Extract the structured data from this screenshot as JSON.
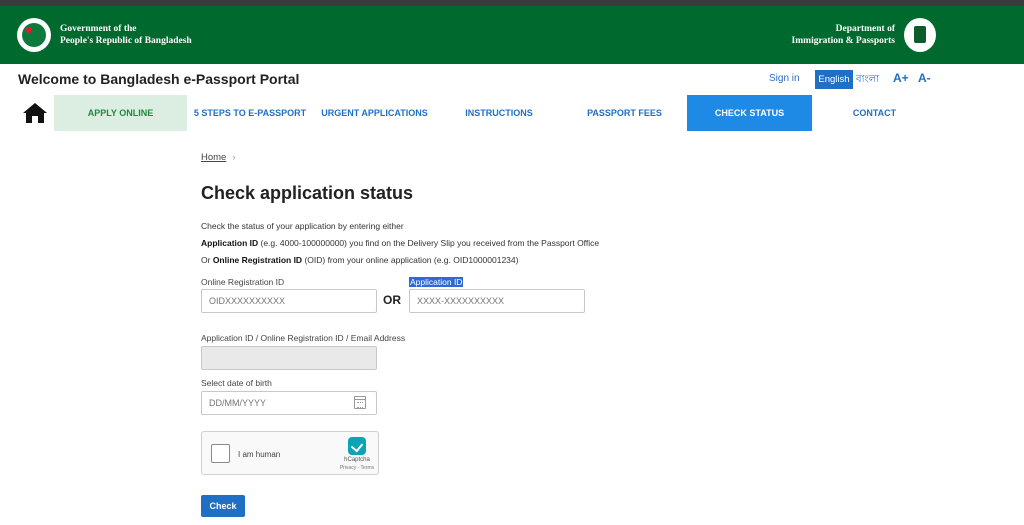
{
  "header": {
    "gov_line1": "Government of the",
    "gov_line2": "People's Republic of Bangladesh",
    "dip_line1": "Department of",
    "dip_line2": "Immigration & Passports"
  },
  "subheader": {
    "welcome": "Welcome to Bangladesh e-Passport Portal",
    "sign_in": "Sign in",
    "lang_english": "English",
    "lang_bangla": "বাংলা",
    "font_increase": "A+",
    "font_decrease": "A-"
  },
  "nav": {
    "home_icon": "home-icon",
    "items": [
      {
        "label": "APPLY ONLINE"
      },
      {
        "label": "5 STEPS TO e-PASSPORT"
      },
      {
        "label": "URGENT APPLICATIONS"
      },
      {
        "label": "INSTRUCTIONS"
      },
      {
        "label": "PASSPORT FEES"
      },
      {
        "label": "CHECK STATUS"
      },
      {
        "label": "CONTACT"
      }
    ]
  },
  "breadcrumb": {
    "home": "Home"
  },
  "main": {
    "title": "Check application status",
    "desc_line1": "Check the status of your application by entering either",
    "desc_line2_bold": "Application ID",
    "desc_line2_rest": " (e.g. 4000-100000000) you find on the Delivery Slip you received from the Passport Office",
    "desc_line3_or": "Or ",
    "desc_line3_bold": "Online Registration ID",
    "desc_line3_rest": " (OID) from your online application (e.g. OID1000001234)"
  },
  "form": {
    "oid_label": "Online Registration ID",
    "oid_placeholder": "OIDXXXXXXXXXX",
    "or_text": "OR",
    "appid_label": "Application ID",
    "appid_placeholder": "XXXX-XXXXXXXXXX",
    "combined_label": "Application ID / Online Registration ID / Email Address",
    "combined_value": "",
    "dob_label": "Select date of birth",
    "dob_placeholder": "DD/MM/YYYY",
    "captcha_label": "I am human",
    "captcha_brand": "hCaptcha",
    "captcha_terms": "Privacy - Terms",
    "submit": "Check"
  },
  "colors": {
    "header_green": "#006a2e",
    "accent_blue": "#1f6fc5",
    "active_tab": "#1f8ae6",
    "apply_tab_bg": "#dceee2"
  }
}
